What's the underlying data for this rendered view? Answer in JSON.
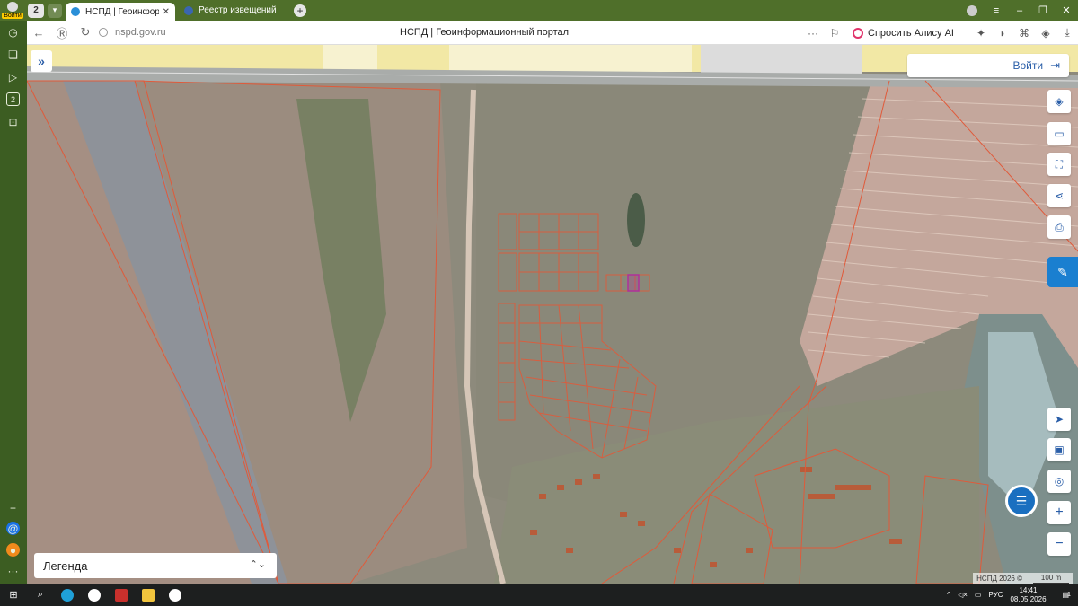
{
  "browser": {
    "login_badge": "Войти",
    "tab_count": "2",
    "tabs": [
      {
        "title": "НСПД | Геоинформаци",
        "active": true
      },
      {
        "title": "Реестр извещений",
        "active": false
      }
    ],
    "url": "nspd.gov.ru",
    "page_title": "НСПД | Геоинформационный портал",
    "alisa_label": "Спросить Алису AI",
    "side_badge": "2"
  },
  "map": {
    "login_label": "Войти",
    "legend_label": "Легенда",
    "attribution": "НСПД 2026 ©",
    "scale_label": "100 m",
    "tools": [
      "layers-icon",
      "ruler-icon",
      "select-area-icon",
      "share-icon",
      "print-icon"
    ],
    "nav_tools": [
      "locate-icon",
      "map-view-icon",
      "location-pin-icon",
      "zoom-in-icon",
      "zoom-out-icon"
    ],
    "colors": {
      "parcel_border": "#e05a3a",
      "selected_parcel": "#b0309a",
      "accent": "#2a5ea8"
    }
  },
  "taskbar": {
    "lang": "РУС",
    "time": "14:41",
    "date": "08.05.2026",
    "notifications": "1"
  }
}
